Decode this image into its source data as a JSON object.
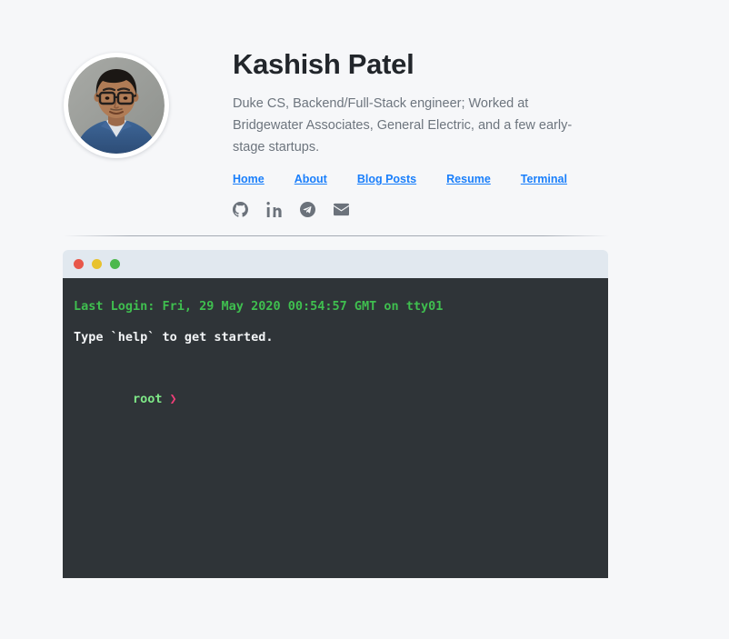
{
  "profile": {
    "name": "Kashish Patel",
    "bio": "Duke CS, Backend/Full-Stack engineer; Worked at Bridgewater Associates, General Electric, and a few early-stage startups.",
    "avatar_alt": "portrait-photo"
  },
  "nav": {
    "link_color": "#1a7ffb",
    "items": [
      {
        "label": "Home"
      },
      {
        "label": "About"
      },
      {
        "label": "Blog Posts"
      },
      {
        "label": "Resume"
      },
      {
        "label": "Terminal"
      }
    ]
  },
  "socials": [
    {
      "name": "github-icon"
    },
    {
      "name": "linkedin-icon"
    },
    {
      "name": "telegram-icon"
    },
    {
      "name": "email-icon"
    }
  ],
  "terminal": {
    "titlebar": {
      "background": "#e1e8ef",
      "dots": [
        {
          "name": "close-dot",
          "color": "#e8574a"
        },
        {
          "name": "minimize-dot",
          "color": "#e8c22e"
        },
        {
          "name": "maximize-dot",
          "color": "#4cb84c"
        }
      ]
    },
    "background": "#2f3438",
    "lines": {
      "last_login": "Last Login: Fri, 29 May 2020 00:54:57 GMT on tty01",
      "help_hint": "Type `help` to get started.",
      "prompt_user": "root",
      "prompt_symbol": "❯"
    },
    "colors": {
      "login_text": "#3fbf4f",
      "body_text": "#f2f4f6",
      "prompt_user": "#7ee787",
      "prompt_symbol": "#ef3e78"
    }
  },
  "theme": {
    "page_background": "#f6f7f9",
    "heading_color": "#22262b",
    "body_text_color": "#6d757e"
  }
}
